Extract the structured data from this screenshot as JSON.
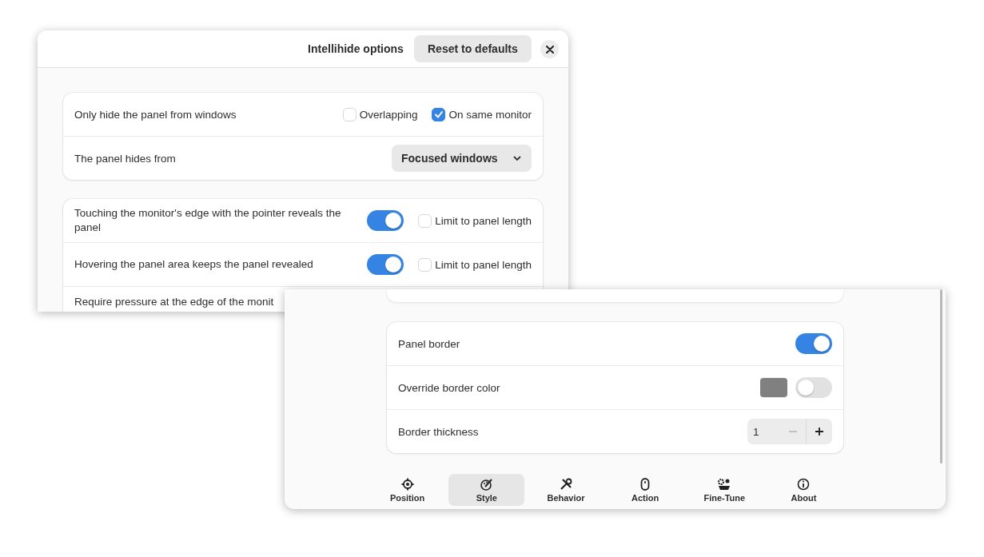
{
  "intellihide_window": {
    "title": "Intellihide options",
    "reset_button": "Reset to defaults",
    "hide_from_windows": {
      "label": "Only hide the panel from windows",
      "options": [
        {
          "label": "Overlapping",
          "checked": false
        },
        {
          "label": "On same monitor",
          "checked": true
        }
      ]
    },
    "hides_from": {
      "label": "The panel hides from",
      "value": "Focused windows"
    },
    "reveal_rows": [
      {
        "label": "Touching the monitor's edge with the pointer reveals the panel",
        "on": true,
        "limit": {
          "label": "Limit to panel length",
          "checked": false
        }
      },
      {
        "label": "Hovering the panel area keeps the panel revealed",
        "on": true,
        "limit": {
          "label": "Limit to panel length",
          "checked": false
        }
      },
      {
        "label": "Require pressure at the edge of the monit"
      }
    ]
  },
  "settings_window": {
    "border_rows": [
      {
        "kind": "toggle",
        "label": "Panel border",
        "on": true
      },
      {
        "kind": "color",
        "label": "Override border color",
        "color": "#808080",
        "on": false
      },
      {
        "kind": "spin",
        "label": "Border thickness",
        "value": "1",
        "decrement_disabled": true
      }
    ],
    "nav": [
      {
        "label": "Position",
        "selected": false
      },
      {
        "label": "Style",
        "selected": true
      },
      {
        "label": "Behavior",
        "selected": false
      },
      {
        "label": "Action",
        "selected": false
      },
      {
        "label": "Fine-Tune",
        "selected": false
      },
      {
        "label": "About",
        "selected": false
      }
    ]
  }
}
